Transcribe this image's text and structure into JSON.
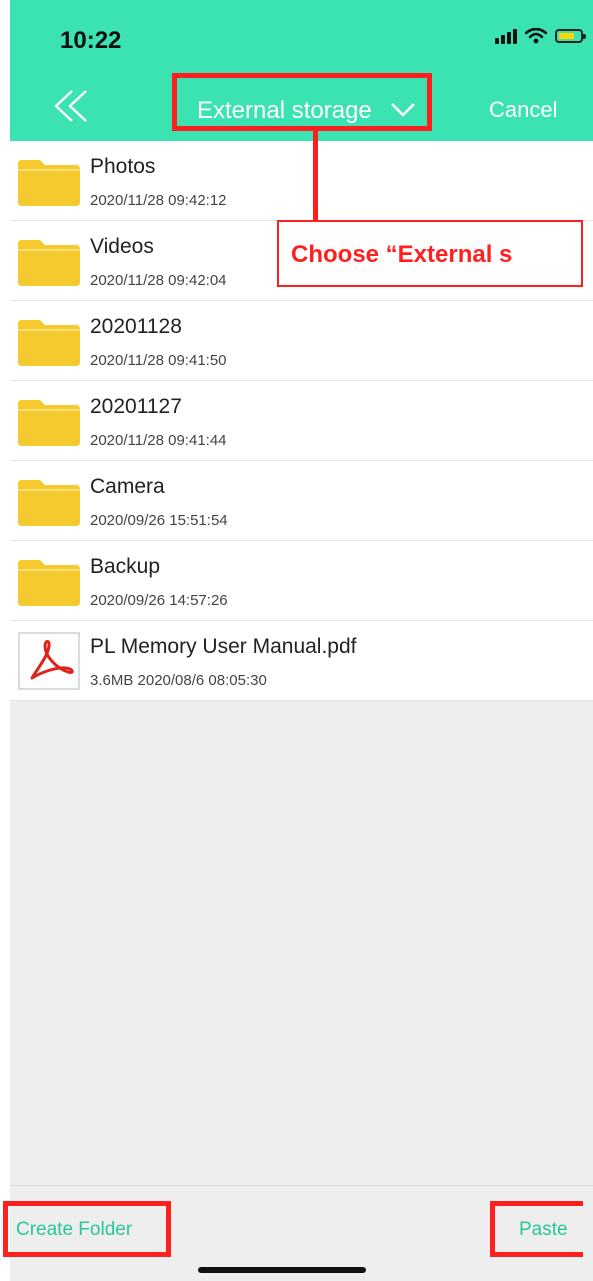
{
  "status_bar": {
    "time": "10:22"
  },
  "header": {
    "title": "External storage",
    "cancel_label": "Cancel"
  },
  "files": [
    {
      "name": "Photos",
      "sub": "2020/11/28 09:42:12",
      "type": "folder"
    },
    {
      "name": "Videos",
      "sub": "2020/11/28 09:42:04",
      "type": "folder"
    },
    {
      "name": "20201128",
      "sub": "2020/11/28 09:41:50",
      "type": "folder"
    },
    {
      "name": "20201127",
      "sub": "2020/11/28 09:41:44",
      "type": "folder"
    },
    {
      "name": "Camera",
      "sub": "2020/09/26 15:51:54",
      "type": "folder"
    },
    {
      "name": "Backup",
      "sub": "2020/09/26 14:57:26",
      "type": "folder"
    },
    {
      "name": "PL Memory User Manual.pdf",
      "sub": "3.6MB 2020/08/6 08:05:30",
      "type": "pdf"
    }
  ],
  "annotation": {
    "text": "Choose “External s"
  },
  "toolbar": {
    "create_folder_label": "Create Folder",
    "paste_label": "Paste"
  },
  "colors": {
    "header_bg": "#3be3b3",
    "accent_text": "#25c89a",
    "annotation": "#ff1f1f",
    "folder": "#f5ca2f"
  }
}
